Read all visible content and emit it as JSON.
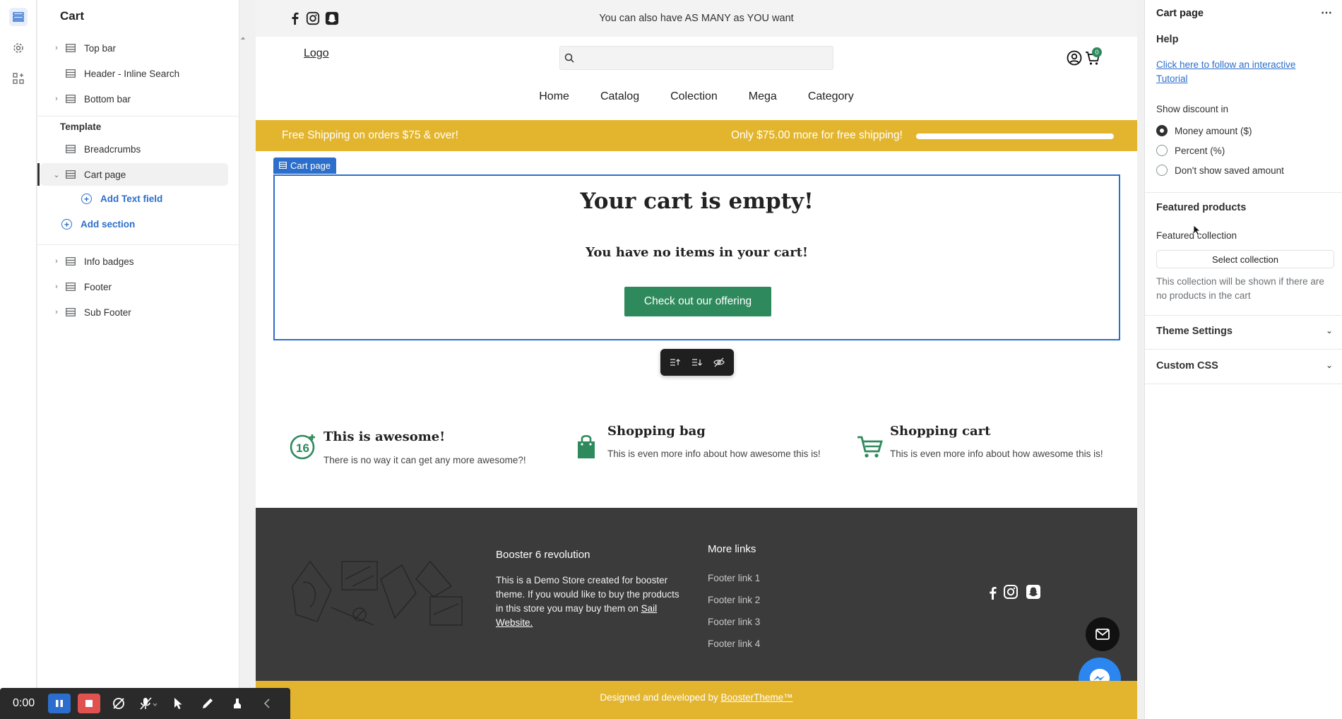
{
  "sidebar": {
    "title": "Cart",
    "sections_top": [
      {
        "label": "Top bar",
        "expandable": true
      },
      {
        "label": "Header - Inline Search",
        "expandable": false
      },
      {
        "label": "Bottom bar",
        "expandable": true
      }
    ],
    "template_label": "Template",
    "template_items": [
      {
        "label": "Breadcrumbs"
      },
      {
        "label": "Cart page"
      }
    ],
    "add_text_field": "Add Text field",
    "add_section": "Add section",
    "sections_bottom": [
      {
        "label": "Info badges"
      },
      {
        "label": "Footer"
      },
      {
        "label": "Sub Footer"
      }
    ]
  },
  "preview": {
    "announcement": "You can also have AS MANY as YOU want",
    "logo": "Logo",
    "cart_count": "0",
    "nav": [
      "Home",
      "Catalog",
      "Colection",
      "Mega",
      "Category"
    ],
    "promo_left": "Free Shipping on orders $75 & over!",
    "promo_right": "Only $75.00 more for free shipping!",
    "promo_progress": 1.0,
    "cart_tag": "Cart page",
    "cart_title": "Your cart is empty!",
    "cart_subtitle": "You have no items in your cart!",
    "cart_button": "Check out our offering",
    "badges": [
      {
        "title": "This is awesome!",
        "desc": "There is no way it can get any more awesome?!",
        "icon": "sixteen-plus-icon"
      },
      {
        "title": "Shopping bag",
        "desc": "This is even more info about how awesome this is!",
        "icon": "shopping-bag-icon"
      },
      {
        "title": "Shopping cart",
        "desc": "This is even more info about how awesome this is!",
        "icon": "shopping-cart-icon"
      }
    ],
    "footer": {
      "brand": "Booster 6 revolution",
      "desc_prefix": "This is a Demo Store created for booster theme. If you would like to buy the products in this store you may buy them on ",
      "desc_link": "Sail Website.",
      "links_title": "More links",
      "links": [
        "Footer link 1",
        "Footer link 2",
        "Footer link 3",
        "Footer link 4"
      ]
    },
    "subfooter_prefix": "Designed and developed by ",
    "subfooter_link": "BoosterTheme™"
  },
  "settings": {
    "title": "Cart page",
    "help_heading": "Help",
    "help_link": "Click here to follow an interactive Tutorial",
    "discount_label": "Show discount in",
    "discount_options": [
      {
        "label": "Money amount ($)",
        "selected": true
      },
      {
        "label": "Percent (%)",
        "selected": false
      },
      {
        "label": "Don't show saved amount",
        "selected": false
      }
    ],
    "featured_heading": "Featured products",
    "featured_collection_label": "Featured collection",
    "select_collection": "Select collection",
    "featured_note": "This collection will be shown if there are no products in the cart",
    "theme_settings": "Theme Settings",
    "custom_css": "Custom CSS"
  },
  "recorder": {
    "time": "0:00"
  },
  "colors": {
    "accent": "#2c6ecb",
    "promo_yellow": "#e3b52e",
    "cart_button_green": "#2e8a5c",
    "footer_dark": "#3b3b3b"
  }
}
